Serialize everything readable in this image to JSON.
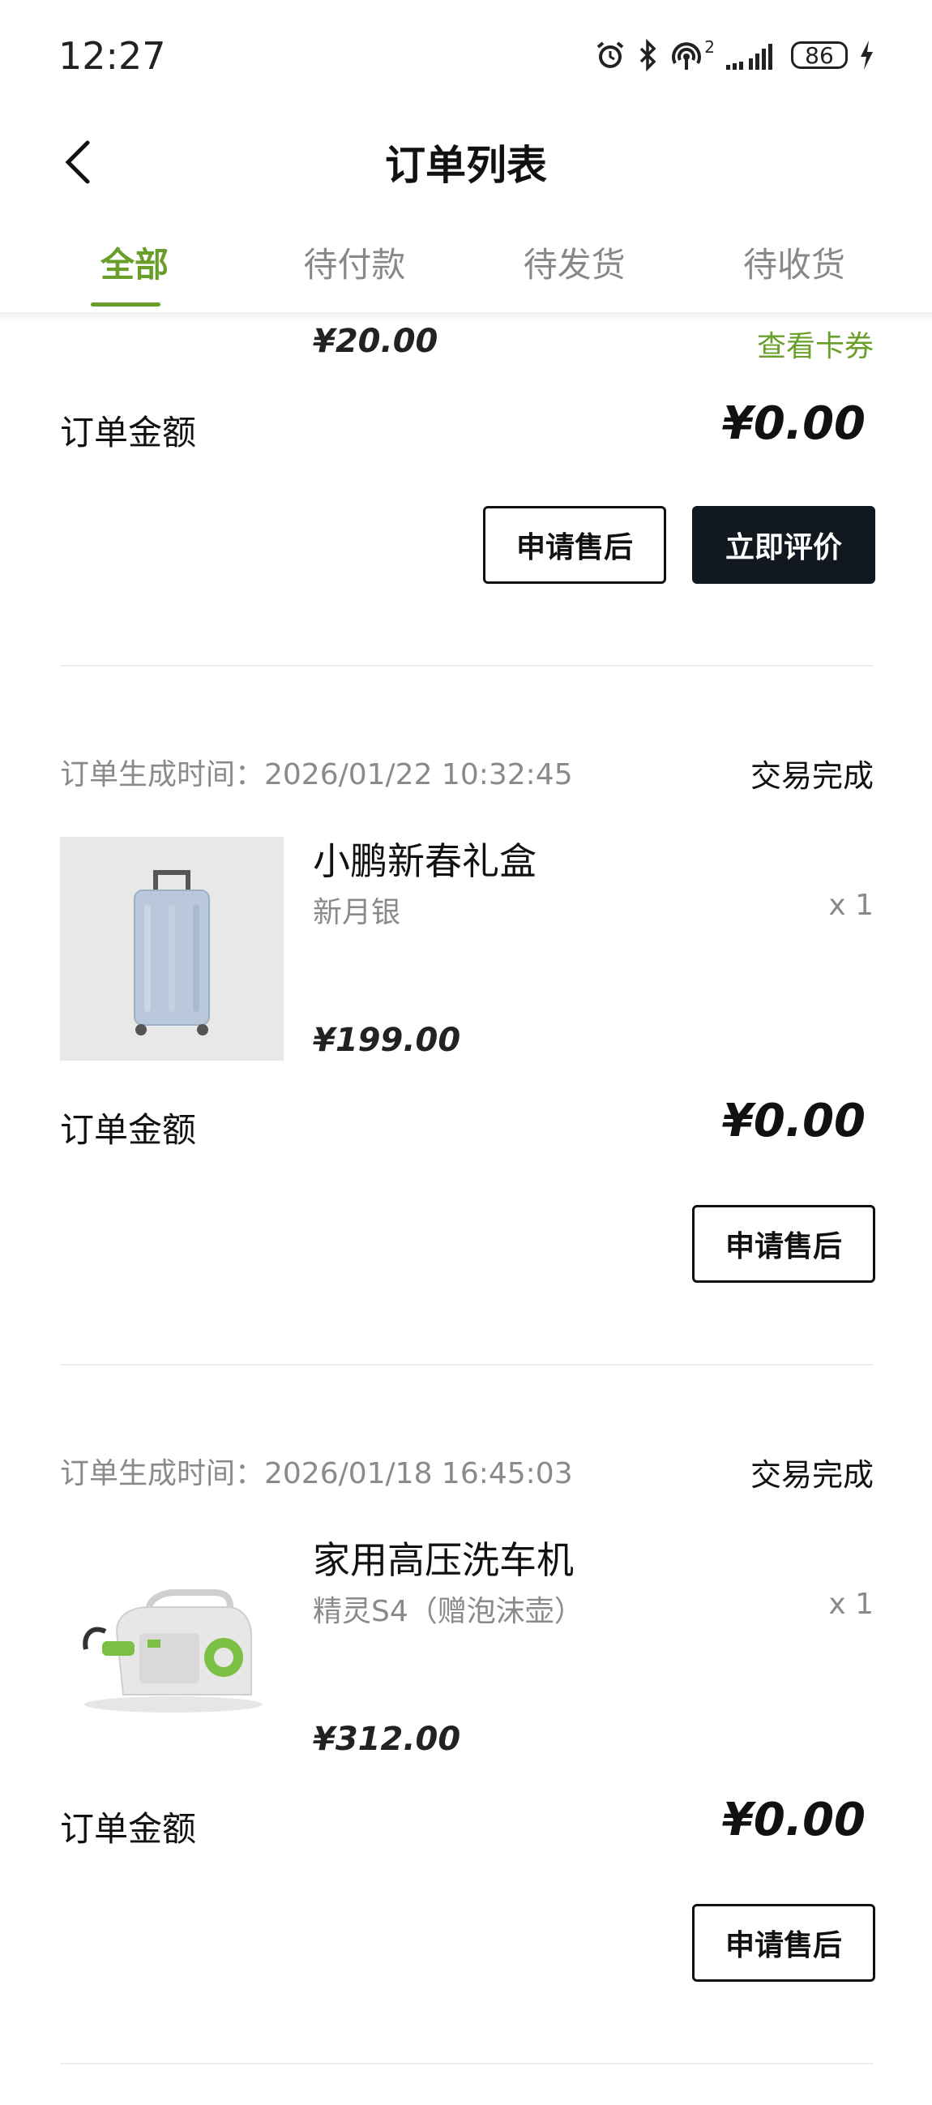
{
  "status_bar": {
    "time": "12:27",
    "signal_superscript": "2",
    "battery": "86"
  },
  "header": {
    "title": "订单列表"
  },
  "tabs": [
    {
      "label": "全部",
      "active": true
    },
    {
      "label": "待付款",
      "active": false
    },
    {
      "label": "待发货",
      "active": false
    },
    {
      "label": "待收货",
      "active": false
    }
  ],
  "orders": [
    {
      "item_price": "¥20.00",
      "view_coupon": "查看卡券",
      "amount_label": "订单金额",
      "amount": "¥0.00",
      "buttons": [
        "申请售后",
        "立即评价"
      ]
    },
    {
      "time_label": "订单生成时间：2026/01/22 10:32:45",
      "status": "交易完成",
      "product_name": "小鹏新春礼盒",
      "spec": "新月银",
      "qty": "x 1",
      "item_price": "¥199.00",
      "amount_label": "订单金额",
      "amount": "¥0.00",
      "buttons": [
        "申请售后"
      ],
      "image": "suitcase"
    },
    {
      "time_label": "订单生成时间：2026/01/18 16:45:03",
      "status": "交易完成",
      "product_name": "家用高压洗车机",
      "spec": "精灵S4（赠泡沫壶）",
      "qty": "x 1",
      "item_price": "¥312.00",
      "amount_label": "订单金额",
      "amount": "¥0.00",
      "buttons": [
        "申请售后"
      ],
      "image": "pressure-washer"
    }
  ],
  "colors": {
    "accent_green": "#6a9e2a",
    "dark_button": "#111820"
  }
}
